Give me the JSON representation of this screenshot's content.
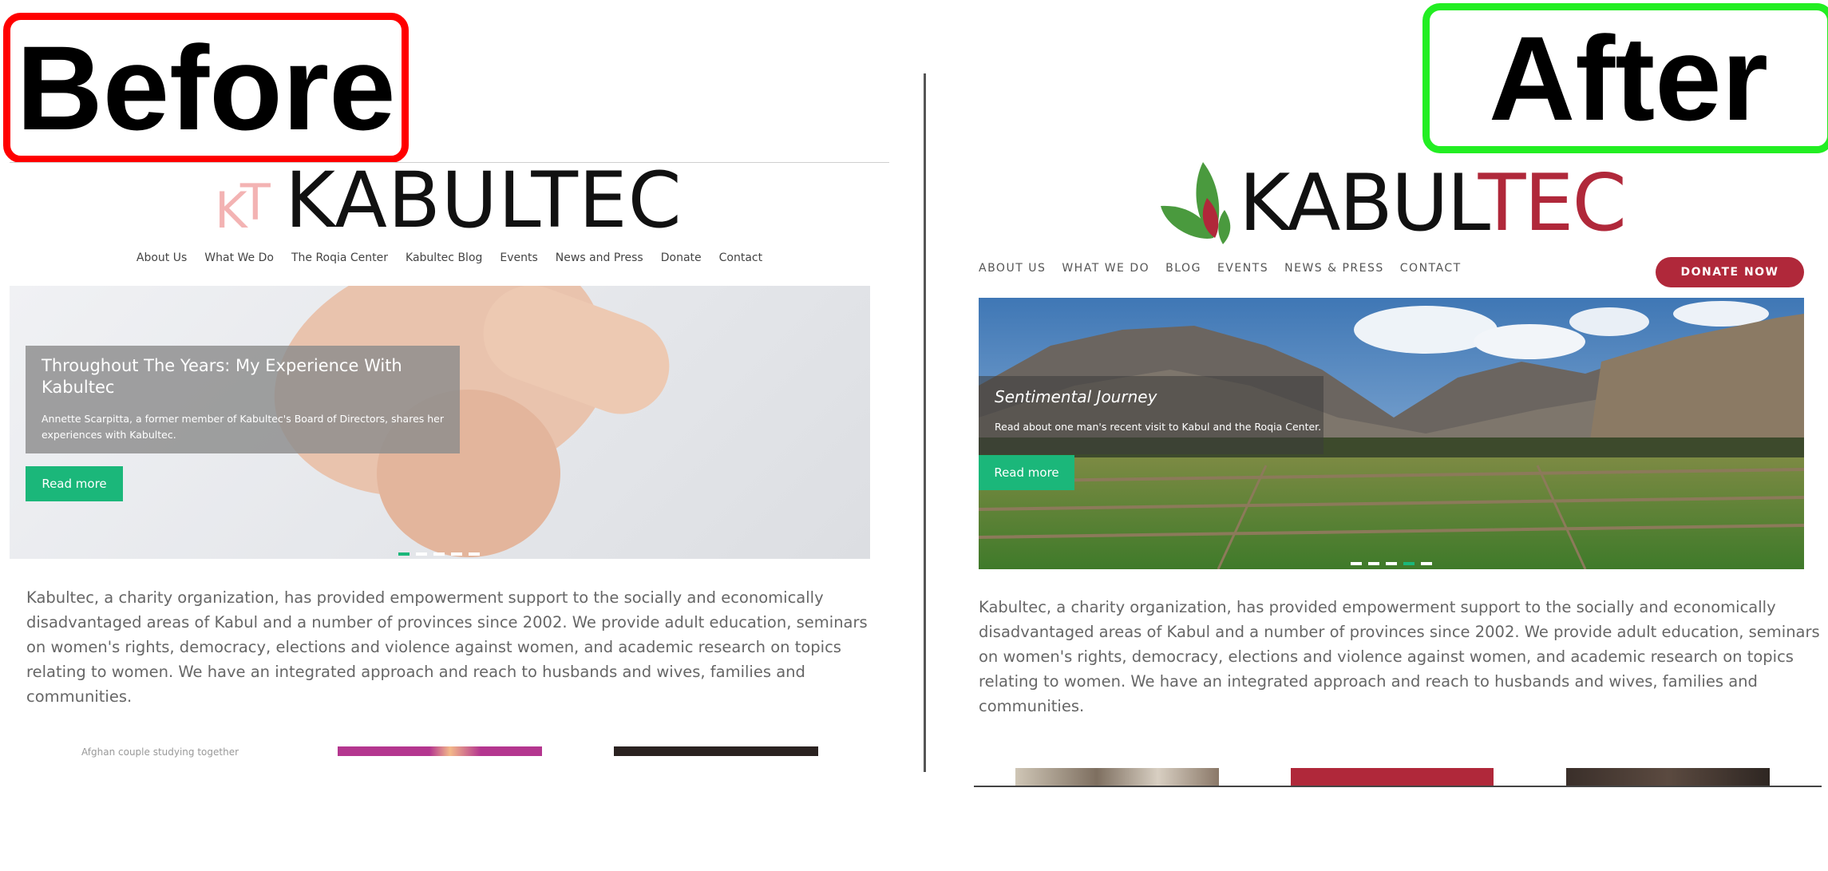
{
  "labels": {
    "before": "Before",
    "after": "After"
  },
  "before": {
    "logo_letters": {
      "k": "K",
      "t": "T"
    },
    "logo_word": "KABULTEC",
    "nav": [
      "About Us",
      "What We Do",
      "The Roqia Center",
      "Kabultec Blog",
      "Events",
      "News and Press",
      "Donate",
      "Contact"
    ],
    "hero": {
      "title": "Throughout The Years: My Experience With Kabultec",
      "description": "Annette Scarpitta, a former member of Kabultec's Board of Directors, shares her experiences with Kabultec.",
      "button": "Read more",
      "active_slide": 1,
      "slide_count": 5
    },
    "intro": "Kabultec, a charity organization, has provided empowerment support to the socially and economically disadvantaged areas of Kabul and a number of provinces since 2002. We provide adult education, seminars on women's rights, democracy, elections and violence against women, and academic research on topics relating to women. We have an integrated approach and reach to husbands and wives, families and communities.",
    "thumb_alt": "Afghan couple studying together"
  },
  "after": {
    "logo_word": {
      "black": "KABUL",
      "red": "TEC"
    },
    "nav": [
      "ABOUT US",
      "WHAT WE DO",
      "BLOG",
      "EVENTS",
      "NEWS & PRESS",
      "CONTACT"
    ],
    "donate": "DONATE NOW",
    "hero": {
      "title": "Sentimental Journey",
      "description": "Read about one man's recent visit to Kabul and the Roqia Center.",
      "button": "Read more",
      "active_slide": 4,
      "slide_count": 5
    },
    "intro": "Kabultec, a charity organization, has provided empowerment support to the socially and economically disadvantaged areas of Kabul and a number of provinces since 2002. We provide adult education, seminars on women's rights, democracy, elections and violence against women, and academic research on topics relating to women. We have an integrated approach and reach to husbands and wives, families and communities."
  },
  "colors": {
    "before_border": "#ff0000",
    "after_border": "#22ee22",
    "accent_green": "#1bb77a",
    "brand_red": "#b0283a",
    "logo_green": "#4a9a3e"
  }
}
